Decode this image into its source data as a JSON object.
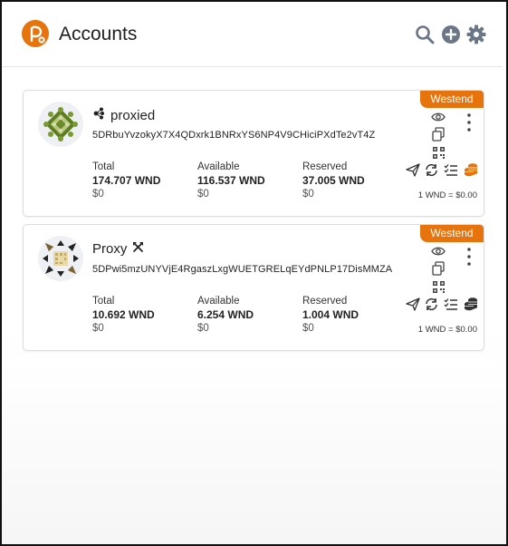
{
  "header": {
    "title": "Accounts",
    "icons": [
      "search-icon",
      "add-circle-icon",
      "settings-icon"
    ]
  },
  "colors": {
    "accent": "#e6730b",
    "icon_gray": "#6b7687"
  },
  "accounts": [
    {
      "name": "proxied",
      "name_icon": "proxied-icon",
      "network_badge": "Westend",
      "address": "5DRbuYvzokyX7X4QDxrk1BNRxYS6NP4V9CHiciPXdTe2vT4Z",
      "balances": [
        {
          "label": "Total",
          "amount": "174.707 WND",
          "fiat": "$0"
        },
        {
          "label": "Available",
          "amount": "116.537 WND",
          "fiat": "$0"
        },
        {
          "label": "Reserved",
          "amount": "37.005 WND",
          "fiat": "$0"
        }
      ],
      "rate": "1 WND = $0.00"
    },
    {
      "name": "Proxy",
      "name_icon": "hammer-pick-icon",
      "network_badge": "Westend",
      "address": "5DPwi5mzUNYVjE4RgaszLxgWUETGRELqEYdPNLP17DisMMZA",
      "balances": [
        {
          "label": "Total",
          "amount": "10.692 WND",
          "fiat": "$0"
        },
        {
          "label": "Available",
          "amount": "6.254 WND",
          "fiat": "$0"
        },
        {
          "label": "Reserved",
          "amount": "1.004 WND",
          "fiat": "$0"
        }
      ],
      "rate": "1 WND = $0.00"
    }
  ]
}
